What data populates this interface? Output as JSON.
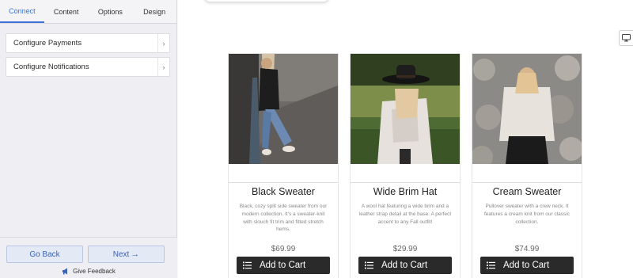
{
  "tabs": [
    {
      "label": "Connect",
      "active": true
    },
    {
      "label": "Content",
      "active": false
    },
    {
      "label": "Options",
      "active": false
    },
    {
      "label": "Design",
      "active": false
    }
  ],
  "config_items": [
    {
      "label": "Configure Payments"
    },
    {
      "label": "Configure Notifications"
    }
  ],
  "footer": {
    "back_label": "Go Back",
    "next_label": "Next",
    "next_arrow": "→",
    "feedback_label": "Give Feedback"
  },
  "products": [
    {
      "title": "Black Sweater",
      "description": "Black, cozy split side sweater from our modern collection. It's a sweater-knit with slouch fit trim and fitted stretch hems.",
      "price": "$69.99",
      "cart_label": "Add to Cart"
    },
    {
      "title": "Wide Brim Hat",
      "description": "A wool hat featuring a wide brim and a leather strap detail at the base. A perfect accent to any Fall outfit!",
      "price": "$29.99",
      "cart_label": "Add to Cart"
    },
    {
      "title": "Cream Sweater",
      "description": "Pullover sweater with a crew neck. It features a cream knit from our classic collection.",
      "price": "$74.99",
      "cart_label": "Add to Cart"
    }
  ],
  "colors": {
    "accent": "#3b73d8",
    "cart_button": "#2a2a2a"
  }
}
